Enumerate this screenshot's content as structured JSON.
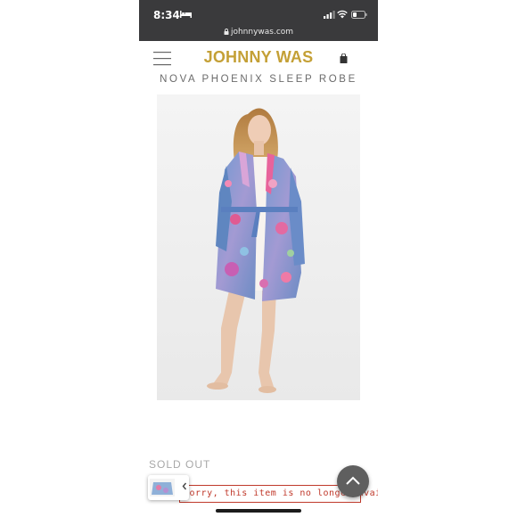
{
  "status_bar": {
    "time": "8:34",
    "url": "johnnywas.com"
  },
  "header": {
    "brand": "JOHNNY WAS",
    "menu_icon": "hamburger-menu-icon",
    "cart_icon": "shopping-bag-icon"
  },
  "product": {
    "title": "NOVA PHOENIX SLEEP ROBE",
    "stock_status": "SOLD OUT",
    "notice": "Sorry, this item is no longer available"
  },
  "colors": {
    "brand_gold": "#c4a036",
    "status_bar_bg": "#3a3a3c",
    "notice_red": "#c0392b",
    "robe_blue": "#6d8fc7"
  }
}
